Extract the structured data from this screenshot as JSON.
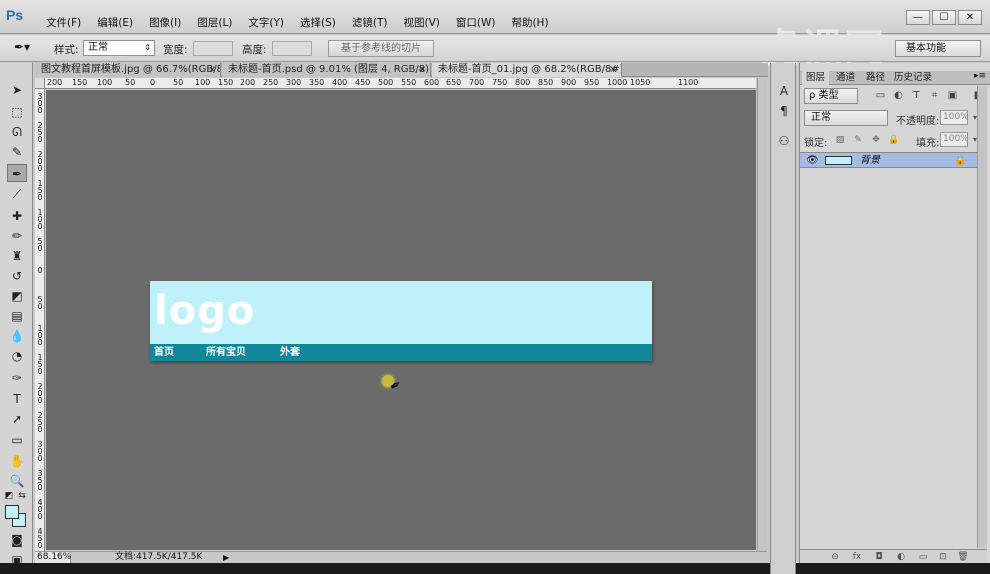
{
  "app": {
    "logo": "Ps",
    "watermark": "虎课网"
  },
  "menu": [
    "文件(F)",
    "编辑(E)",
    "图像(I)",
    "图层(L)",
    "文字(Y)",
    "选择(S)",
    "滤镜(T)",
    "视图(V)",
    "窗口(W)",
    "帮助(H)"
  ],
  "window_controls": {
    "minimize": "—",
    "maximize": "☐",
    "close": "✕"
  },
  "options": {
    "style_label": "样式:",
    "style_value": "正常",
    "width_label": "宽度:",
    "height_label": "高度:",
    "slice_button": "基于参考线的切片",
    "workspace": "基本功能"
  },
  "tabs": [
    {
      "label": "图文教程首屏模板.jpg @ 66.7%(RGB/8)",
      "close": "×"
    },
    {
      "label": "未标题-首页.psd @ 9.01% (图层 4, RGB/8) *",
      "close": "×"
    },
    {
      "label": "未标题-首页_01.jpg @ 68.2%(RGB/8#) *",
      "close": "×"
    }
  ],
  "ruler_top": [
    "200",
    "150",
    "100",
    "50",
    "0",
    "50",
    "100",
    "150",
    "200",
    "250",
    "300",
    "350",
    "400",
    "450",
    "500",
    "550",
    "600",
    "650",
    "700",
    "750",
    "800",
    "850",
    "900",
    "950",
    "1000",
    "1050",
    "1100"
  ],
  "ruler_left_groups": [
    "300",
    "250",
    "200",
    "150",
    "100",
    "50",
    "0",
    "50",
    "100",
    "150",
    "200",
    "250",
    "300",
    "350",
    "400",
    "450"
  ],
  "document": {
    "logo_text": "logo",
    "nav": [
      "首页",
      "所有宝贝",
      "外套"
    ],
    "banner_color": "#bff1fa",
    "nav_color": "#13879a"
  },
  "status": {
    "zoom": "68.16%",
    "doc_info": "文档:417.5K/417.5K",
    "arrow": "▶"
  },
  "layers_panel": {
    "tabs": [
      "图层",
      "通道",
      "路径",
      "历史记录"
    ],
    "menu_icon": "▸≡",
    "filter_label": "ρ 类型",
    "blend_mode": "正常",
    "opacity_label": "不透明度:",
    "opacity_value": "100%",
    "lock_label": "锁定:",
    "fill_label": "填充:",
    "fill_value": "100%",
    "layer_name": "背景"
  },
  "colors": {
    "foreground": "#bff1fa",
    "background": "#bff1fa",
    "canvas": "#6b6b6b",
    "selected_layer": "#a6bbe0"
  }
}
